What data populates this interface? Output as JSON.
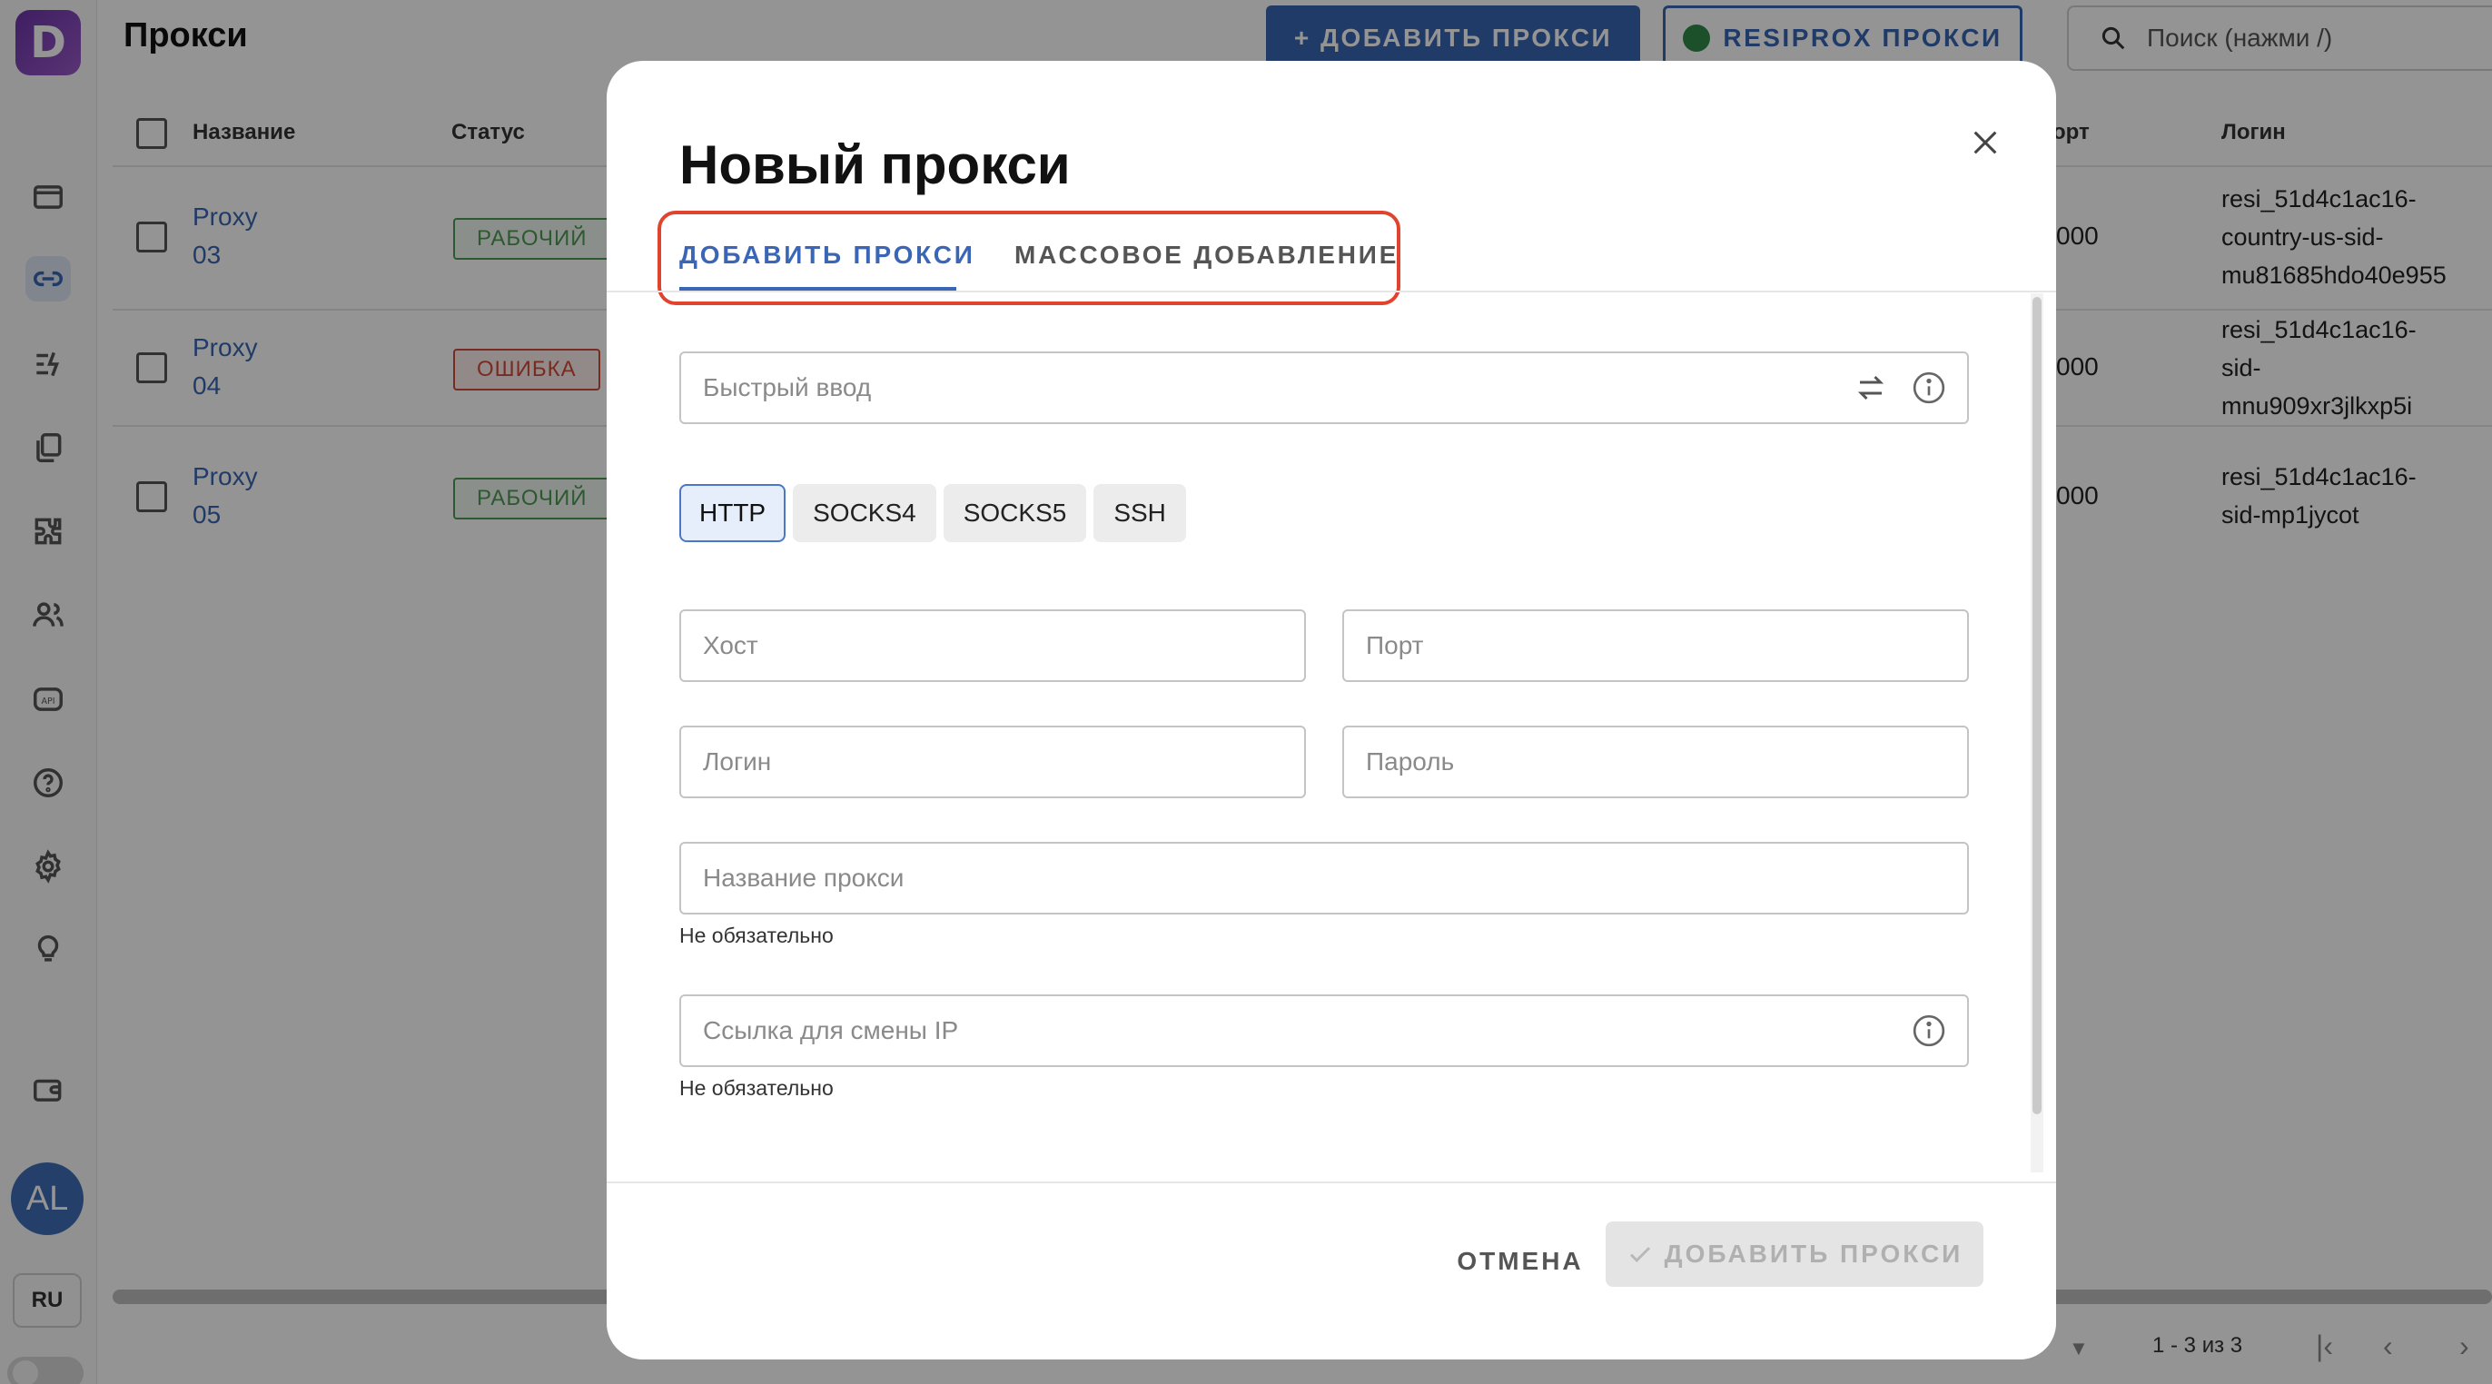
{
  "app": {
    "logo_letter": "D",
    "page_title": "Прокси",
    "add_proxy_button": "+ ДОБАВИТЬ ПРОКСИ",
    "resiprox_button": "RESIPROX ПРОКСИ",
    "search_placeholder": "Поиск (нажми /)",
    "avatar_initials": "AL",
    "language": "RU",
    "sidebar_icons": [
      "browser-icon",
      "link-icon",
      "automation-icon",
      "copy-icon",
      "extension-icon",
      "users-icon",
      "api-icon",
      "help-icon",
      "settings-icon",
      "lightbulb-icon",
      "wallet-icon"
    ],
    "accent_color": "#3a66b5"
  },
  "table": {
    "columns": [
      "Название",
      "Статус",
      "орт",
      "Логин"
    ],
    "rows": [
      {
        "name_line1": "Proxy",
        "name_line2": "03",
        "status": "РАБОЧИЙ",
        "status_type": "ok",
        "port": "000",
        "login_lines": [
          "resi_51d4c1ac16-",
          "country-us-sid-",
          "mu81685hdo40e955"
        ]
      },
      {
        "name_line1": "Proxy",
        "name_line2": "04",
        "status": "ОШИБКА",
        "status_type": "err",
        "port": "000",
        "login_lines": [
          "resi_51d4c1ac16-",
          "sid-",
          "mnu909xr3jlkxp5i"
        ]
      },
      {
        "name_line1": "Proxy",
        "name_line2": "05",
        "status": "РАБОЧИЙ",
        "status_type": "ok",
        "port": "000",
        "login_lines": [
          "resi_51d4c1ac16-",
          "sid-mp1jycot"
        ]
      }
    ],
    "pagination": "1 - 3 из 3"
  },
  "modal": {
    "title": "Новый прокси",
    "tabs": [
      {
        "label": "ДОБАВИТЬ ПРОКСИ",
        "active": true
      },
      {
        "label": "МАССОВОЕ ДОБАВЛЕНИЕ",
        "active": false
      }
    ],
    "quick_input_placeholder": "Быстрый ввод",
    "protocols": [
      "HTTP",
      "SOCKS4",
      "SOCKS5",
      "SSH"
    ],
    "selected_protocol": "HTTP",
    "host_placeholder": "Хост",
    "port_placeholder": "Порт",
    "login_placeholder": "Логин",
    "password_placeholder": "Пароль",
    "proxy_name_placeholder": "Название прокси",
    "proxy_name_help": "Не обязательно",
    "change_ip_placeholder": "Ссылка для смены IP",
    "change_ip_help": "Не обязательно",
    "cancel_button": "ОТМЕНА",
    "submit_button": "ДОБАВИТЬ ПРОКСИ",
    "highlight_color": "#e0442f"
  }
}
